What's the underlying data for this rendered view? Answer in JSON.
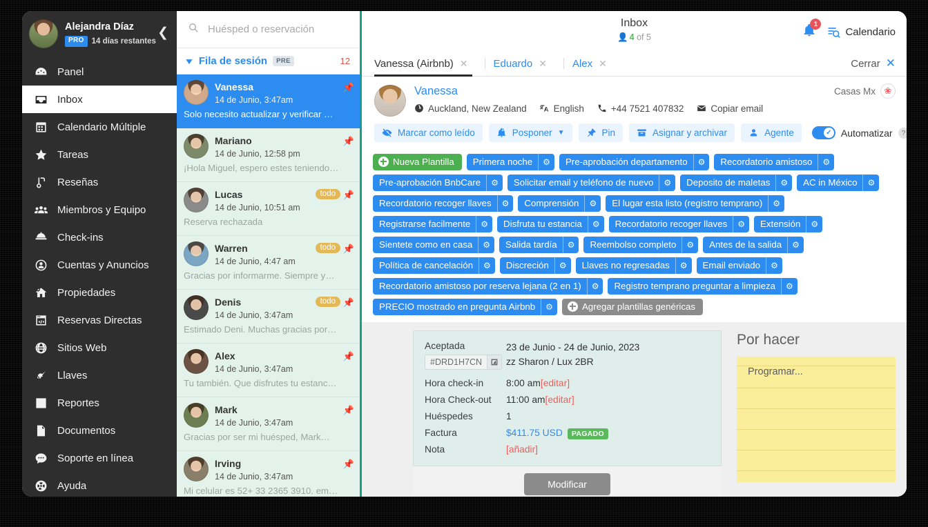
{
  "sidebar": {
    "profile": {
      "name": "Alejandra Díaz",
      "badge": "PRO",
      "days_left": "14 días restantes"
    },
    "items": [
      {
        "label": "Panel",
        "icon": "dashboard-icon"
      },
      {
        "label": "Inbox",
        "icon": "inbox-icon"
      },
      {
        "label": "Calendario Múltiple",
        "icon": "calendar-icon"
      },
      {
        "label": "Tareas",
        "icon": "star-icon"
      },
      {
        "label": "Reseñas",
        "icon": "review-icon"
      },
      {
        "label": "Miembros y Equipo",
        "icon": "users-icon"
      },
      {
        "label": "Check-ins",
        "icon": "bell-desk-icon"
      },
      {
        "label": "Cuentas y Anuncios",
        "icon": "account-icon"
      },
      {
        "label": "Propiedades",
        "icon": "home-icon"
      },
      {
        "label": "Reservas Directas",
        "icon": "code-window-icon"
      },
      {
        "label": "Sitios Web",
        "icon": "globe-icon"
      },
      {
        "label": "Llaves",
        "icon": "key-icon"
      },
      {
        "label": "Reportes",
        "icon": "bar-chart-icon"
      },
      {
        "label": "Documentos",
        "icon": "document-icon"
      },
      {
        "label": "Soporte en línea",
        "icon": "chat-icon"
      },
      {
        "label": "Ayuda",
        "icon": "lifebuoy-icon"
      }
    ]
  },
  "list_panel": {
    "search_placeholder": "Huésped o reservación",
    "queue": {
      "title": "Fila de sesión",
      "badge": "PRE",
      "count": "12"
    },
    "conversations": [
      {
        "name": "Vanessa",
        "date": "14 de Junio, 3:47am",
        "snippet": "Solo necesito actualizar y verificar mi....",
        "todo": "",
        "avatar": "#cfa98a"
      },
      {
        "name": "Mariano",
        "date": "14 de Junio, 12:58 pm",
        "snippet": "¡Hola Miguel, espero estes teniendo…",
        "todo": "",
        "avatar": "#7d8a6a"
      },
      {
        "name": "Lucas",
        "date": "14 de Junio, 10:51 am",
        "snippet": "Reserva rechazada",
        "todo": "todo",
        "avatar": "#8a8a8a"
      },
      {
        "name": "Warren",
        "date": "14 de Junio, 4:47 am",
        "snippet": "Gracias por informarme. Siempre y…",
        "todo": "todo",
        "avatar": "#7aa6c4"
      },
      {
        "name": "Denis",
        "date": "14 de Junio, 3:47am",
        "snippet": "Estimado Deni. Muchas gracias por tu…",
        "todo": "todo",
        "avatar": "#4a4a4a"
      },
      {
        "name": "Alex",
        "date": "14 de Junio, 3:47am",
        "snippet": "Tu también. Que disfrutes tu estanc…",
        "todo": "",
        "avatar": "#6b5244"
      },
      {
        "name": "Mark",
        "date": "14 de Junio, 3:47am",
        "snippet": "Gracias por ser mi huésped, Mark…",
        "todo": "",
        "avatar": "#6d7f52"
      },
      {
        "name": "Irving",
        "date": "14 de Junio, 3:47am",
        "snippet": "Mi celular es 52+ 33 2365 3910. em…",
        "todo": "",
        "avatar": "#8a7f6a"
      }
    ]
  },
  "main": {
    "header": {
      "title": "Inbox",
      "subcount": "4",
      "subtext": "of 5",
      "notification_count": "1",
      "calendar_label": "Calendario"
    },
    "tabs": [
      {
        "label": "Vanessa (Airbnb)",
        "active": true
      },
      {
        "label": "Eduardo",
        "active": false
      },
      {
        "label": "Alex",
        "active": false
      }
    ],
    "close_label": "Cerrar",
    "guest": {
      "name": "Vanessa",
      "location": "Auckland, New Zealand",
      "language": "English",
      "phone": "+44 7521 407832",
      "copy_email": "Copiar email",
      "account": "Casas Mx"
    },
    "actions": [
      {
        "label": "Marcar como leído",
        "icon": "eye-slash-icon"
      },
      {
        "label": "Posponer",
        "icon": "snooze-bell-icon",
        "caret": true
      },
      {
        "label": "Pin",
        "icon": "pin-icon"
      },
      {
        "label": "Asignar y archivar",
        "icon": "archive-icon"
      },
      {
        "label": "Agente",
        "icon": "person-icon"
      }
    ],
    "automate": {
      "label": "Automatizar",
      "help": "?"
    },
    "templates": [
      {
        "label": "Nueva Plantilla",
        "style": "green",
        "plus": true
      },
      {
        "label": "Primera noche",
        "style": "blue"
      },
      {
        "label": "Pre-aprobación departamento",
        "style": "blue"
      },
      {
        "label": "Recordatorio amistoso",
        "style": "blue"
      },
      {
        "label": "Pre-aprobación BnbCare",
        "style": "blue"
      },
      {
        "label": "Solicitar email y teléfono de nuevo",
        "style": "blue"
      },
      {
        "label": "Deposito de maletas",
        "style": "blue"
      },
      {
        "label": "AC in México",
        "style": "blue"
      },
      {
        "label": "Recordatorio recoger llaves",
        "style": "blue"
      },
      {
        "label": "Comprensión",
        "style": "blue"
      },
      {
        "label": "El lugar esta listo (registro temprano)",
        "style": "blue"
      },
      {
        "label": "Registrarse facilmente",
        "style": "blue"
      },
      {
        "label": "Disfruta tu estancia",
        "style": "blue"
      },
      {
        "label": "Recordatorio recoger llaves",
        "style": "blue"
      },
      {
        "label": "Extensión",
        "style": "blue"
      },
      {
        "label": "Sientete como en casa",
        "style": "blue"
      },
      {
        "label": "Salida tardía",
        "style": "blue"
      },
      {
        "label": "Reembolso completo",
        "style": "blue"
      },
      {
        "label": "Antes de la salida",
        "style": "blue"
      },
      {
        "label": "Política de cancelación",
        "style": "blue"
      },
      {
        "label": "Discreción",
        "style": "blue"
      },
      {
        "label": "Llaves no regresadas",
        "style": "blue"
      },
      {
        "label": "Email enviado",
        "style": "blue"
      },
      {
        "label": "Recordatorio amistoso por reserva lejana (2 en 1)",
        "style": "blue"
      },
      {
        "label": "Registro temprano preguntar a limpieza",
        "style": "blue"
      },
      {
        "label": "PRECIO mostrado en pregunta Airbnb",
        "style": "blue"
      },
      {
        "label": "Agregar plantillas genéricas",
        "style": "grey",
        "plus": true
      }
    ],
    "reservation": {
      "status": "Aceptada",
      "code": "#DRD1H7CN",
      "dates": "23 de Junio - 24 de Junio, 2023",
      "property": "zz Sharon / Lux 2BR",
      "rows": [
        {
          "label": "Hora check-in",
          "value": "8:00 am",
          "link": "[editar]"
        },
        {
          "label": "Hora Check-out",
          "value": "11:00 am",
          "link": "[editar]"
        },
        {
          "label": "Huéspedes",
          "value": "1",
          "link": ""
        },
        {
          "label": "Factura",
          "value": "$411.75 USD",
          "badge": "PAGADO",
          "link": ""
        },
        {
          "label": "Nota",
          "value": "",
          "link": "[añadir]"
        }
      ],
      "modify_button": "Modificar"
    },
    "todo_panel": {
      "title": "Por hacer",
      "note_placeholder": "Programar..."
    }
  }
}
